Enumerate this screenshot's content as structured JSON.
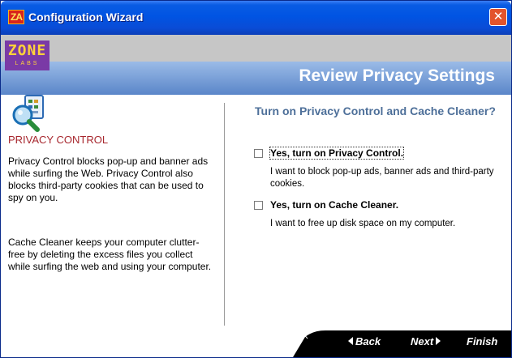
{
  "window": {
    "title": "Configuration Wizard",
    "app_icon_text": "ZA",
    "close_symbol": "✕"
  },
  "banner": {
    "logo_text": "ZONE",
    "logo_subtext": "LABS",
    "page_title": "Review Privacy Settings"
  },
  "left_panel": {
    "icon": "privacy-control-icon",
    "heading": "PRIVACY CONTROL",
    "paragraph1": "Privacy Control blocks pop-up and banner ads while surfing the Web. Privacy Control also blocks third-party cookies that can be used to spy on you.",
    "paragraph2": "Cache Cleaner keeps your computer clutter-free by deleting the excess files you collect while surfing the web and using your computer."
  },
  "right_panel": {
    "question": "Turn on Privacy Control and Cache Cleaner?",
    "options": [
      {
        "label": "Yes, turn on Privacy Control.",
        "description": "I want to block pop-up ads, banner ads and third-party cookies.",
        "checked": false
      },
      {
        "label": "Yes, turn on Cache Cleaner.",
        "description": "I want to free up disk space on my computer.",
        "checked": false
      }
    ]
  },
  "footer": {
    "back_label": "Back",
    "next_label": "Next",
    "finish_label": "Finish"
  },
  "colors": {
    "titlebar": "#0054e3",
    "heading_red": "#a7272e",
    "question_blue": "#4d6f99",
    "banner_band": "#5a86c9",
    "logo_purple": "#7a3aa6",
    "footer": "#000000"
  }
}
